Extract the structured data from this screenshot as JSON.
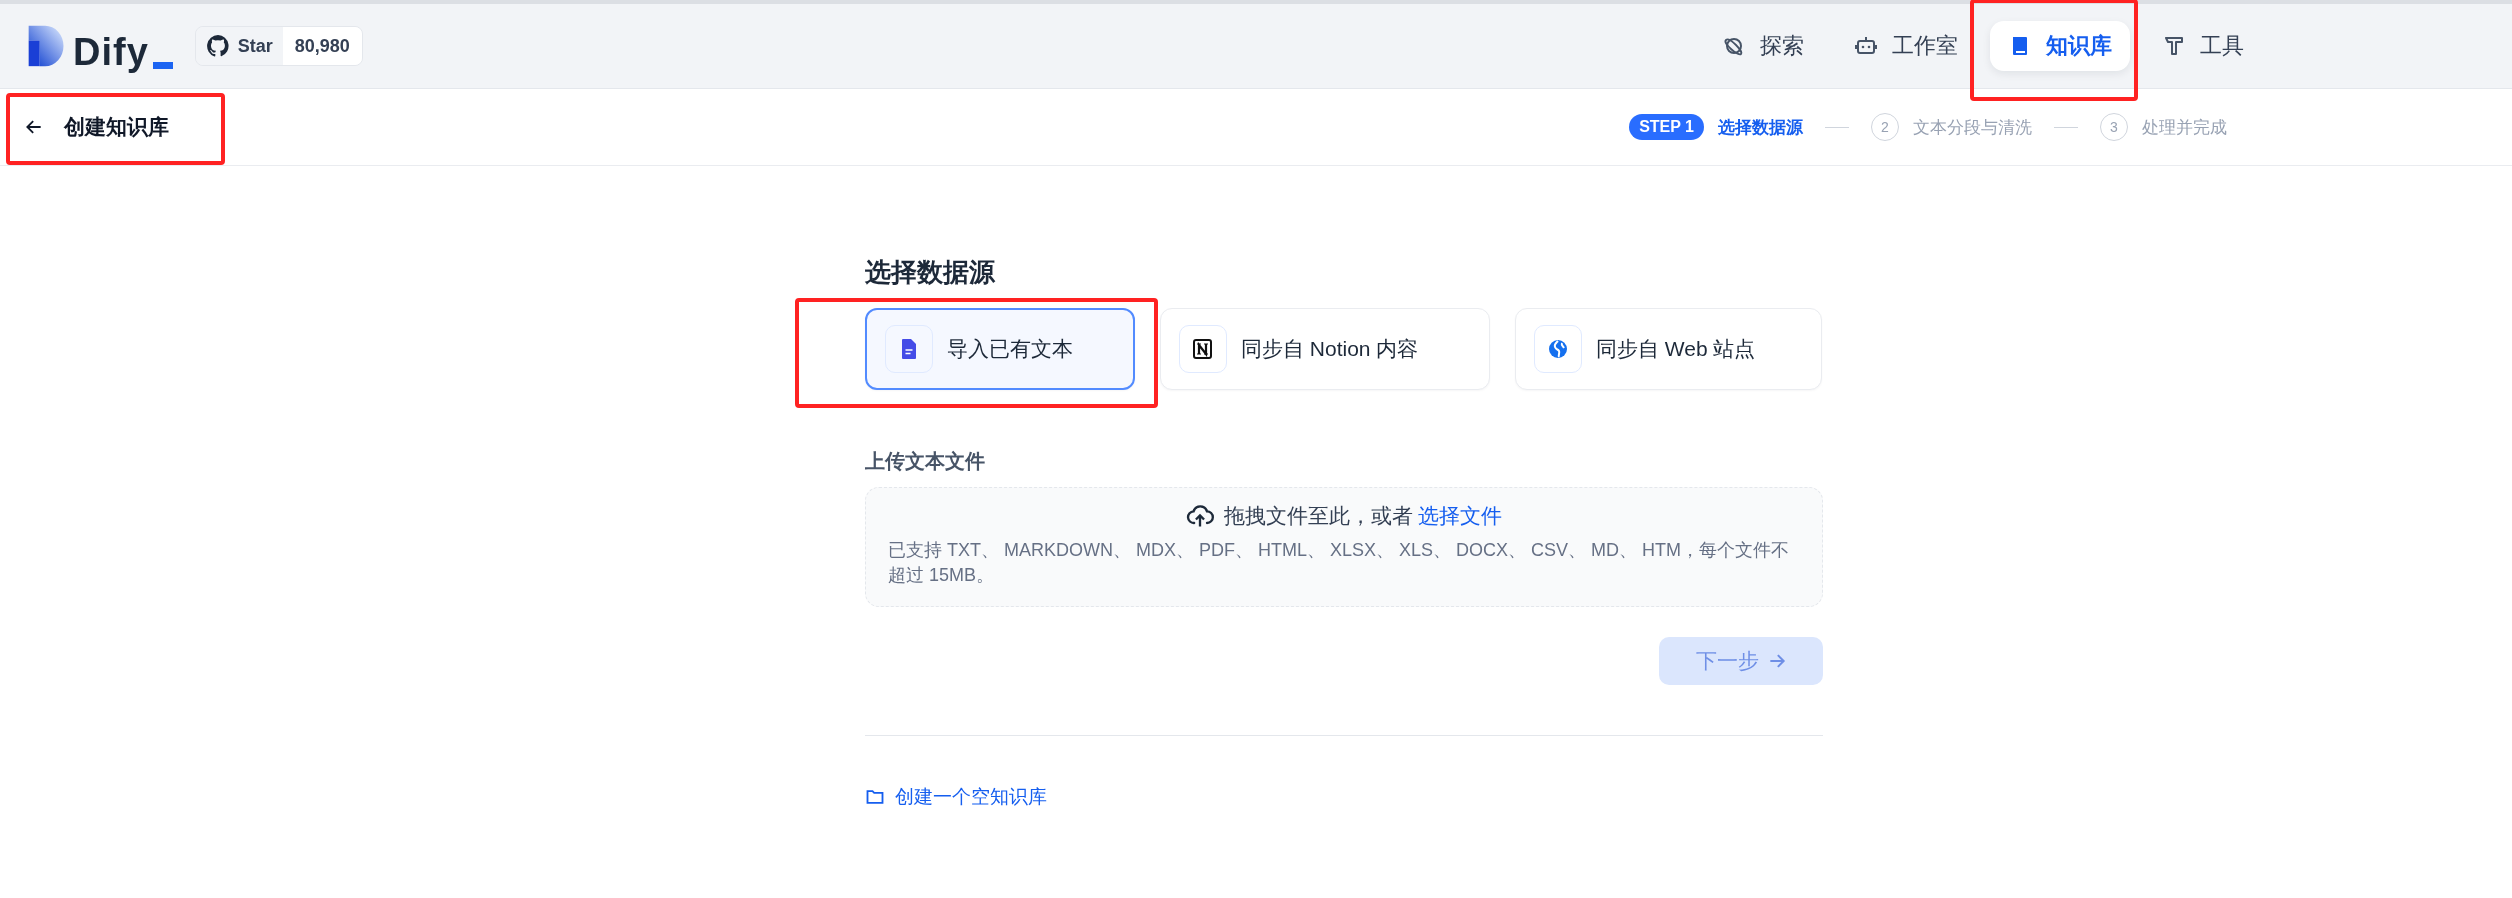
{
  "header": {
    "logo": "Dify",
    "github": {
      "label": "Star",
      "count": "80,980"
    },
    "nav": [
      {
        "label": "探索",
        "kind": "explore",
        "selected": false,
        "highlighted": false
      },
      {
        "label": "工作室",
        "kind": "studio",
        "selected": false,
        "highlighted": false
      },
      {
        "label": "知识库",
        "kind": "knowledge",
        "selected": true,
        "highlighted": true
      },
      {
        "label": "工具",
        "kind": "tools",
        "selected": false,
        "highlighted": false
      }
    ]
  },
  "subheader": {
    "title": "创建知识库",
    "highlighted": true,
    "steps": [
      {
        "number": "STEP 1",
        "label": "选择数据源",
        "selected": true
      },
      {
        "number": "2",
        "label": "文本分段与清洗",
        "selected": false
      },
      {
        "number": "3",
        "label": "处理并完成",
        "selected": false
      }
    ]
  },
  "datasource": {
    "title": "选择数据源",
    "sources": [
      {
        "label": "导入已有文本",
        "kind": "file",
        "selected": true,
        "highlighted": true
      },
      {
        "label": "同步自 Notion 内容",
        "kind": "notion",
        "selected": false,
        "highlighted": false
      },
      {
        "label": "同步自 Web 站点",
        "kind": "web",
        "selected": false,
        "highlighted": false
      }
    ],
    "upload": {
      "label": "上传文本文件",
      "drop_text": "拖拽文件至此，或者",
      "browse_link": "选择文件",
      "hint": "已支持 TXT、 MARKDOWN、 MDX、 PDF、 HTML、 XLSX、 XLS、 DOCX、 CSV、 MD、 HTM，每个文件不超过 15MB。"
    },
    "next_button": {
      "label": "下一步",
      "disabled": true
    },
    "empty_link": "创建一个空知识库"
  }
}
